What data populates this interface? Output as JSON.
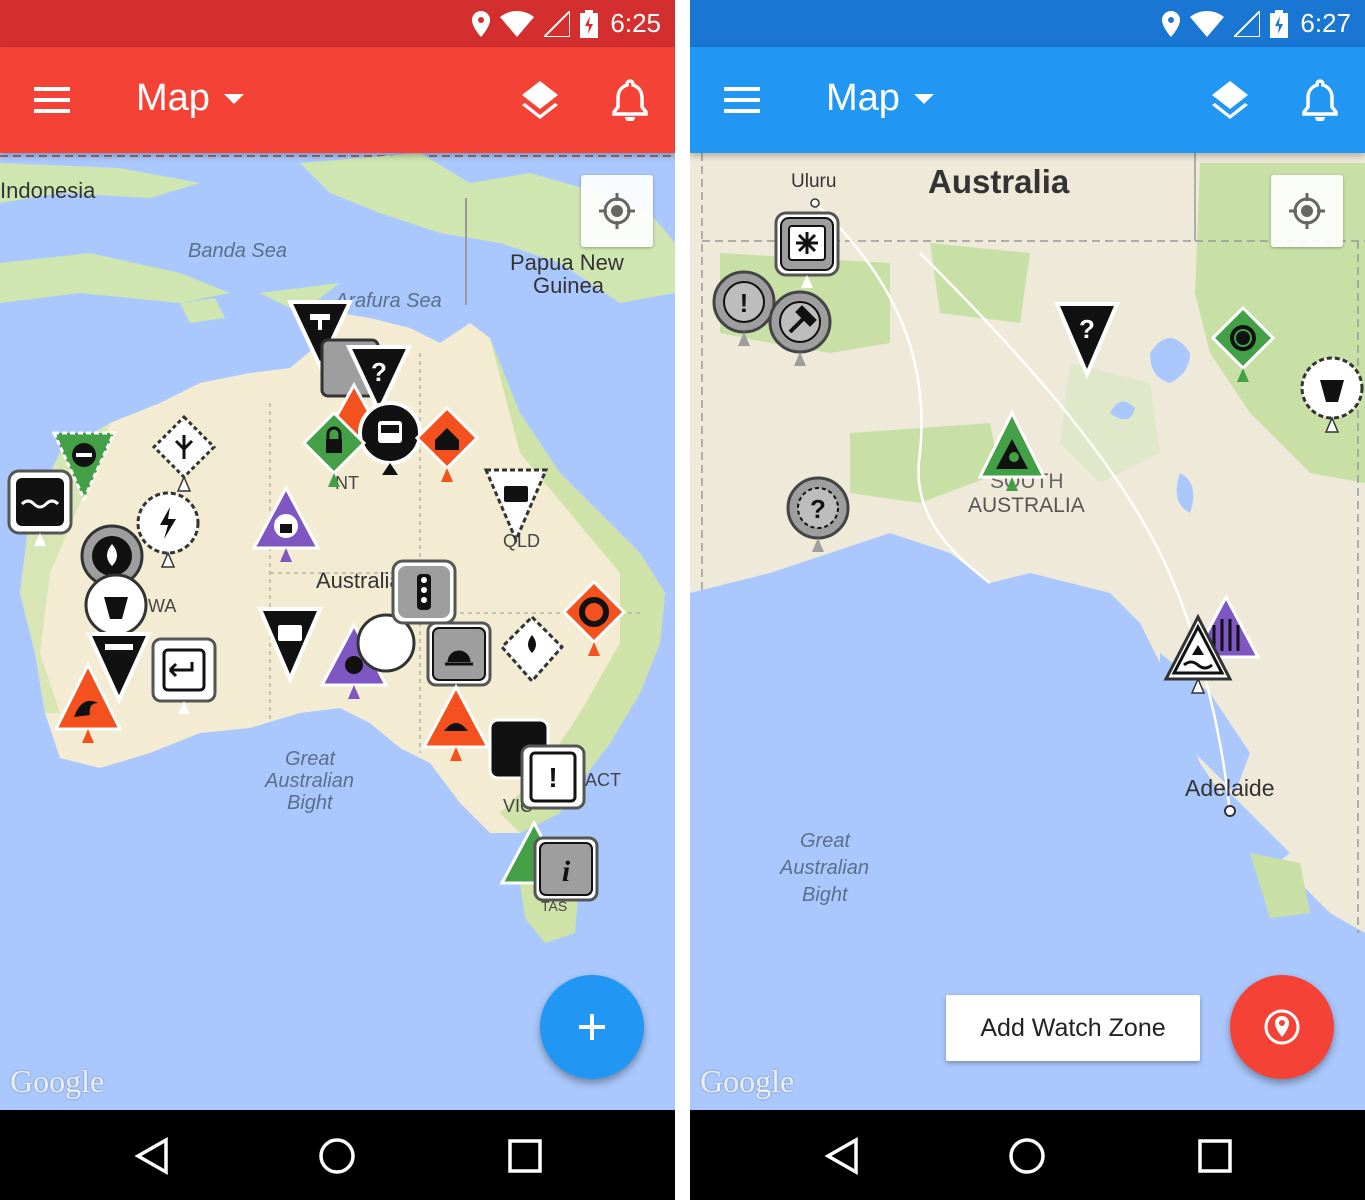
{
  "left": {
    "status": {
      "time": "6:25",
      "color": "#d32f2f"
    },
    "appbar": {
      "title": "Map",
      "color": "#f44336"
    },
    "map_labels": {
      "indonesia": "Indonesia",
      "banda_sea": "Banda Sea",
      "papua": "Papua New",
      "papua2": "Guinea",
      "arafura": "Arafura Sea",
      "australia": "Australia",
      "wa": "WA",
      "nt": "NT",
      "qld": "QLD",
      "gab1": "Great",
      "gab2": "Australian",
      "gab3": "Bight",
      "act": "ACT",
      "vic": "VIC",
      "tas": "TAS"
    },
    "google": "Google",
    "fab": {
      "icon": "plus-icon",
      "color": "#2196f3"
    }
  },
  "right": {
    "status": {
      "time": "6:27",
      "color": "#1976d2"
    },
    "appbar": {
      "title": "Map",
      "color": "#2196f3"
    },
    "map_labels": {
      "uluru": "Uluru",
      "australia": "Australia",
      "sa1": "SOUTH",
      "sa2": "AUSTRALIA",
      "adelaide": "Adelaide",
      "gab1": "Great",
      "gab2": "Australian",
      "gab3": "Bight"
    },
    "google": "Google",
    "watch_zone": "Add Watch Zone",
    "fab": {
      "icon": "watch-zone-pin-icon",
      "color": "#f44336"
    }
  },
  "colors": {
    "water": "#aac8fd",
    "land": "#efe9d9",
    "park": "#c8e0a6",
    "black": "#111111",
    "grey": "#9e9e9e",
    "green": "#43a047",
    "orange": "#f4511e",
    "purple": "#7e57c2",
    "white": "#ffffff"
  }
}
